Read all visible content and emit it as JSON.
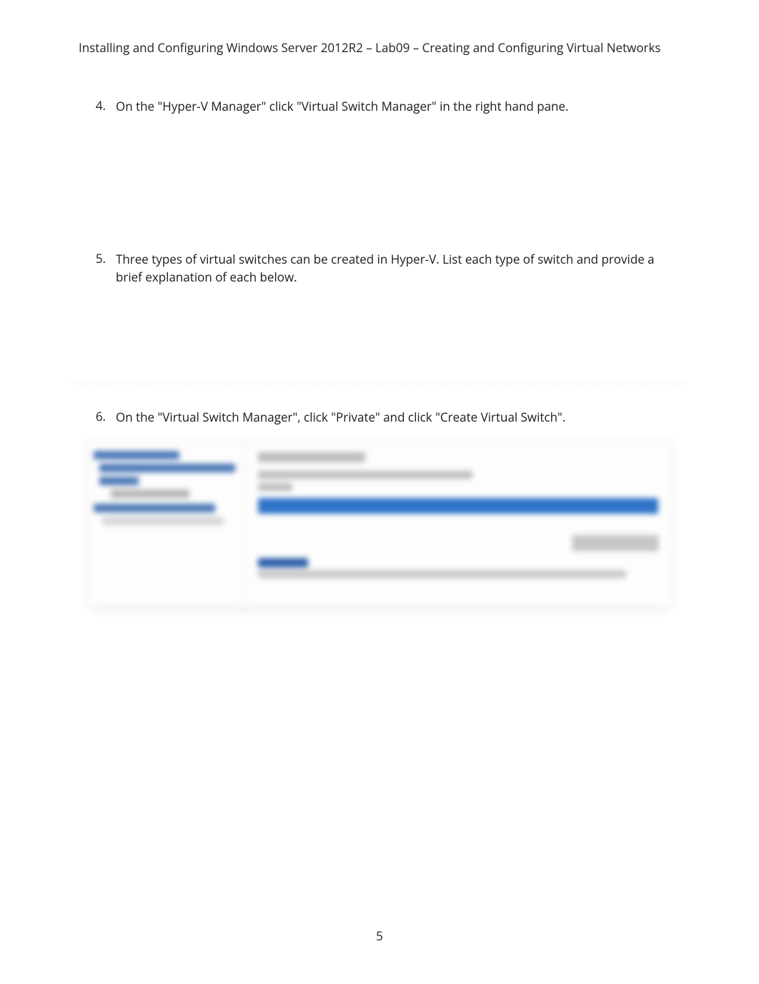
{
  "header": "Installing and Configuring Windows Server 2012R2 – Lab09 – Creating and Configuring Virtual Networks",
  "items": [
    {
      "num": "4.",
      "text": "On the \"Hyper-V Manager\" click \"Virtual Switch Manager\" in the right hand pane."
    },
    {
      "num": "5.",
      "text": "Three types of virtual switches can be created in Hyper-V. List each type of switch and provide a brief explanation of each below."
    },
    {
      "num": "6.",
      "text": "On the \"Virtual Switch Manager\", click \"Private\" and click \"Create Virtual Switch\"."
    }
  ],
  "pageNumber": "5"
}
